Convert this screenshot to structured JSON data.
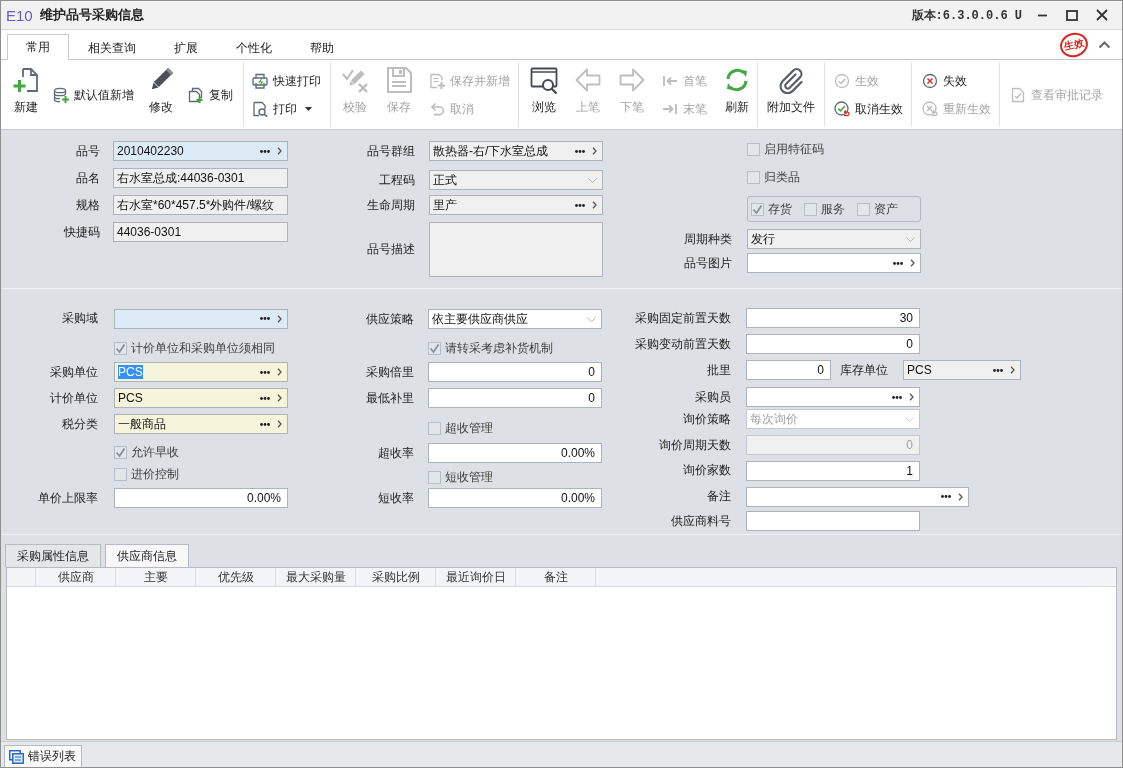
{
  "window": {
    "logo": "E10",
    "title": "维护品号采购信息",
    "version": "版本:6.3.0.0.6 U"
  },
  "ribbon": {
    "tabs": [
      {
        "label": "常用",
        "selected": true
      },
      {
        "label": "相关查询",
        "selected": false
      },
      {
        "label": "扩展",
        "selected": false
      },
      {
        "label": "个性化",
        "selected": false
      },
      {
        "label": "帮助",
        "selected": false
      }
    ],
    "stamp": "生效"
  },
  "toolbar": {
    "groups": [
      {
        "columns": [
          [
            {
              "kind": "large",
              "label": "新建",
              "disabled": false,
              "dropdown": false
            }
          ],
          [
            {
              "kind": "small",
              "label": "默认值新增",
              "disabled": false,
              "dropdown": false
            }
          ],
          [
            {
              "kind": "large",
              "label": "修改",
              "disabled": false,
              "dropdown": false
            }
          ],
          [
            {
              "kind": "small",
              "label": "复制",
              "disabled": false,
              "dropdown": false
            }
          ]
        ]
      },
      {
        "columns": [
          [
            {
              "kind": "small",
              "label": "快速打印",
              "disabled": false,
              "dropdown": false
            },
            {
              "kind": "small",
              "label": "打印",
              "disabled": false,
              "dropdown": true
            }
          ]
        ]
      },
      {
        "columns": [
          [
            {
              "kind": "large",
              "label": "校验",
              "disabled": true,
              "dropdown": false
            }
          ],
          [
            {
              "kind": "large",
              "label": "保存",
              "disabled": true,
              "dropdown": false
            }
          ],
          [
            {
              "kind": "small",
              "label": "保存并新增",
              "disabled": true,
              "dropdown": false
            },
            {
              "kind": "small",
              "label": "取消",
              "disabled": true,
              "dropdown": false
            }
          ]
        ]
      },
      {
        "columns": [
          [
            {
              "kind": "large",
              "label": "浏览",
              "disabled": false,
              "dropdown": false
            }
          ],
          [
            {
              "kind": "large",
              "label": "上笔",
              "disabled": true,
              "dropdown": false
            }
          ],
          [
            {
              "kind": "large",
              "label": "下笔",
              "disabled": true,
              "dropdown": false
            }
          ],
          [
            {
              "kind": "small",
              "label": "首笔",
              "disabled": true,
              "dropdown": false
            },
            {
              "kind": "small",
              "label": "末笔",
              "disabled": true,
              "dropdown": false
            }
          ],
          [
            {
              "kind": "large",
              "label": "刷新",
              "disabled": false,
              "dropdown": false
            }
          ]
        ]
      },
      {
        "columns": [
          [
            {
              "kind": "large",
              "label": "附加文件",
              "disabled": false,
              "dropdown": false
            }
          ]
        ]
      },
      {
        "columns": [
          [
            {
              "kind": "small",
              "label": "生效",
              "disabled": true,
              "dropdown": false
            },
            {
              "kind": "small",
              "label": "取消生效",
              "disabled": false,
              "dropdown": false
            }
          ]
        ]
      },
      {
        "columns": [
          [
            {
              "kind": "small",
              "label": "失效",
              "disabled": false,
              "dropdown": false
            },
            {
              "kind": "small",
              "label": "重新生效",
              "disabled": true,
              "dropdown": false
            }
          ]
        ]
      },
      {
        "columns": [
          [
            {
              "kind": "small",
              "label": "查看审批记录",
              "disabled": true,
              "dropdown": false
            }
          ]
        ]
      }
    ]
  },
  "form": {
    "sections": [
      {
        "columns": [
          {
            "rows": [
              {
                "kind": "lookup",
                "label": "品号",
                "value": "2010402230",
                "focused": true,
                "readonly": false,
                "required": false,
                "disabled": false
              },
              {
                "kind": "text",
                "label": "品名",
                "value": "右水室总成:44036-0301",
                "focused": false,
                "readonly": true,
                "required": false,
                "disabled": false
              },
              {
                "kind": "text",
                "label": "规格",
                "value": "右水室*60*457.5*外购件/螺纹",
                "focused": false,
                "readonly": true,
                "required": false,
                "disabled": false
              },
              {
                "kind": "text",
                "label": "快捷码",
                "value": "44036-0301",
                "focused": false,
                "readonly": true,
                "required": false,
                "disabled": false
              }
            ]
          },
          {
            "rows": [
              {
                "kind": "lookup",
                "label": "品号群组",
                "value": "散热器-右/下水室总成",
                "focused": false,
                "readonly": true,
                "required": false,
                "disabled": false
              },
              {
                "kind": "select",
                "label": "工程码",
                "value": "正式",
                "focused": false,
                "readonly": true,
                "required": false,
                "disabled": false
              },
              {
                "kind": "lookup",
                "label": "生命周期",
                "value": "里产",
                "focused": false,
                "readonly": true,
                "required": false,
                "disabled": false
              },
              {
                "kind": "textarea",
                "label": "品号描述",
                "focused": false,
                "readonly": true,
                "required": false,
                "disabled": false
              }
            ]
          },
          {
            "rows": [
              {
                "kind": "checkbox",
                "label": "启用特征码",
                "checked": false
              },
              {
                "kind": "checkbox",
                "label": "归类品",
                "checked": false
              },
              {
                "kind": "checkgroup",
                "options": [
                  {
                    "label": "存货",
                    "checked": true
                  },
                  {
                    "label": "服务",
                    "checked": false
                  },
                  {
                    "label": "资产",
                    "checked": false
                  }
                ]
              },
              {
                "kind": "select",
                "label": "周期种类",
                "value": "发行",
                "focused": false,
                "readonly": true,
                "required": false,
                "disabled": false
              },
              {
                "kind": "lookup",
                "label": "品号图片",
                "focused": false,
                "readonly": false,
                "required": false,
                "disabled": false
              }
            ]
          }
        ]
      },
      {
        "columns": [
          {
            "rows": [
              {
                "kind": "lookup",
                "label": "采购域",
                "focused": true,
                "readonly": false,
                "required": false,
                "disabled": false
              },
              {
                "kind": "checkbox",
                "label": "计价单位和采购单位须相同",
                "checked": true
              },
              {
                "kind": "lookup",
                "label": "采购单位",
                "value": "PCS",
                "text_selected": true,
                "focused": false,
                "readonly": false,
                "required": true,
                "disabled": false
              },
              {
                "kind": "lookup",
                "label": "计价单位",
                "value": "PCS",
                "focused": false,
                "readonly": false,
                "required": true,
                "disabled": false
              },
              {
                "kind": "lookup",
                "label": "税分类",
                "value": "一般商品",
                "focused": false,
                "readonly": false,
                "required": true,
                "disabled": false
              },
              {
                "kind": "checkbox",
                "label": "允许早收",
                "checked": true
              },
              {
                "kind": "checkbox",
                "label": "进价控制",
                "checked": false
              },
              {
                "kind": "number",
                "label": "单价上限率",
                "value": "0.00%",
                "focused": false,
                "readonly": false,
                "required": false,
                "disabled": false
              }
            ]
          },
          {
            "rows": [
              {
                "kind": "select",
                "label": "供应策略",
                "value": "依主要供应商供应",
                "focused": false,
                "readonly": false,
                "required": false,
                "disabled": false
              },
              {
                "kind": "checkbox",
                "label": "请转采考虑补货机制",
                "checked": true
              },
              {
                "kind": "number",
                "label": "采购倍里",
                "value": "0",
                "focused": false,
                "readonly": false,
                "required": false,
                "disabled": false
              },
              {
                "kind": "number",
                "label": "最低补里",
                "value": "0",
                "focused": false,
                "readonly": false,
                "required": false,
                "disabled": false
              },
              {
                "kind": "checkbox",
                "label": "超收管理",
                "checked": false
              },
              {
                "kind": "number",
                "label": "超收率",
                "value": "0.00%",
                "focused": false,
                "readonly": false,
                "required": false,
                "disabled": false
              },
              {
                "kind": "checkbox",
                "label": "短收管理",
                "checked": false
              },
              {
                "kind": "number",
                "label": "短收率",
                "value": "0.00%",
                "focused": false,
                "readonly": false,
                "required": false,
                "disabled": false
              }
            ]
          },
          {
            "rows": [
              {
                "kind": "number",
                "label": "采购固定前置天数",
                "value": "30",
                "focused": false,
                "readonly": false,
                "required": false,
                "disabled": false
              },
              {
                "kind": "number",
                "label": "采购变动前置天数",
                "value": "0",
                "focused": false,
                "readonly": false,
                "required": false,
                "disabled": false
              },
              {
                "kind": "number",
                "label": "批里",
                "value": "0",
                "focused": false,
                "readonly": false,
                "required": false,
                "disabled": false,
                "side": {
                  "kind": "lookup",
                  "label": "库存单位",
                  "value": "PCS",
                  "focused": false,
                  "readonly": true,
                  "required": false,
                  "disabled": false
                }
              },
              {
                "kind": "lookup",
                "label": "采购员",
                "focused": false,
                "readonly": false,
                "required": false,
                "disabled": false
              },
              {
                "kind": "select",
                "label": "询价策略",
                "value": "每次询价",
                "focused": false,
                "readonly": false,
                "required": false,
                "disabled": true
              },
              {
                "kind": "number",
                "label": "询价周期天数",
                "value": "0",
                "focused": false,
                "readonly": true,
                "required": false,
                "disabled": true
              },
              {
                "kind": "number",
                "label": "询价家数",
                "value": "1",
                "focused": false,
                "readonly": false,
                "required": false,
                "disabled": false
              },
              {
                "kind": "lookup",
                "label": "备注",
                "focused": false,
                "readonly": false,
                "required": false,
                "disabled": false
              },
              {
                "kind": "text",
                "label": "供应商料号",
                "focused": false,
                "readonly": false,
                "required": false,
                "disabled": false
              }
            ]
          }
        ]
      }
    ]
  },
  "detail": {
    "tabs": [
      {
        "label": "采购属性信息",
        "selected": false
      },
      {
        "label": "供应商信息",
        "selected": true
      }
    ],
    "table": {
      "columns": [
        "供应商",
        "主要",
        "优先级",
        "最大采购量",
        "采购比例",
        "最近询价日",
        "备注"
      ]
    }
  },
  "status_bar": {
    "tabs": [
      {
        "label": "错误列表"
      }
    ]
  }
}
